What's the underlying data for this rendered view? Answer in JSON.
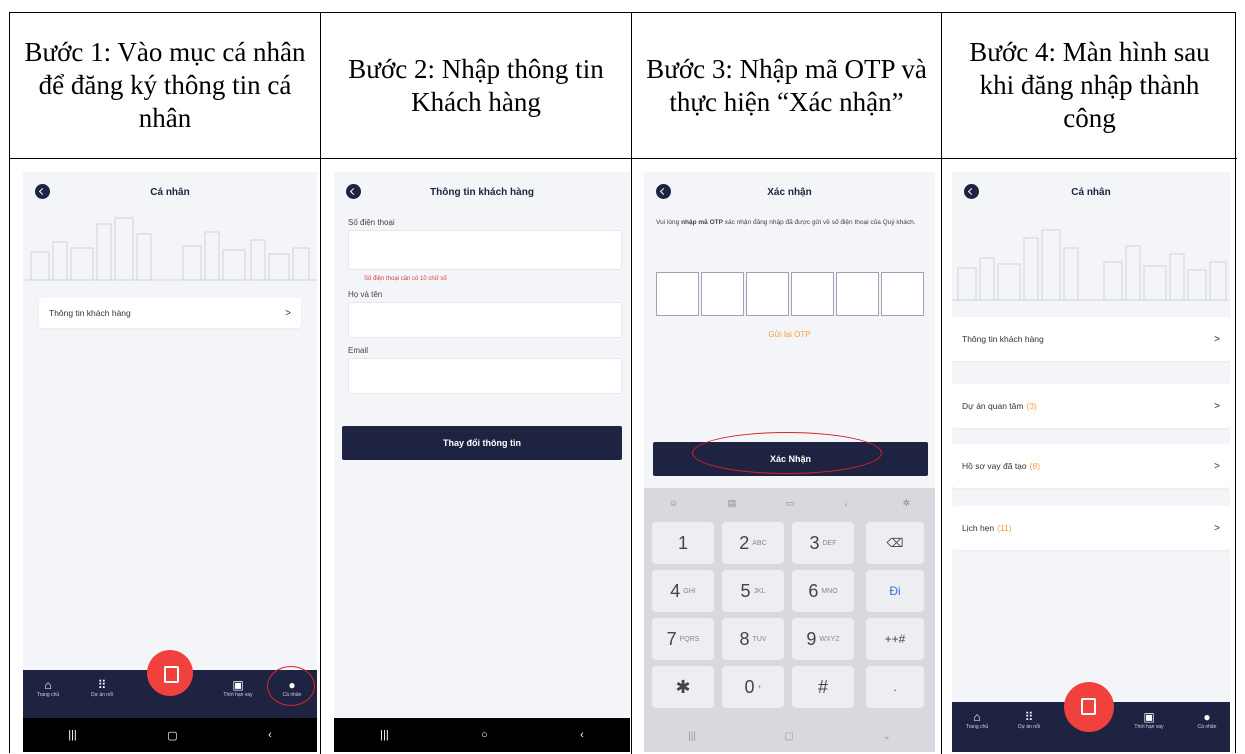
{
  "steps": [
    {
      "title": "Bước 1: Vào mục cá nhân để đăng ký thông tin cá nhân"
    },
    {
      "title": "Bước 2: Nhập thông tin Khách hàng"
    },
    {
      "title": "Bước 3: Nhập mã OTP và thực hiện “Xác nhận”"
    },
    {
      "title": "Bước 4: Màn hình sau khi đăng nhập thành công"
    }
  ],
  "screen1": {
    "title": "Cá nhân",
    "menu": [
      {
        "label": "Thông tin khách hàng",
        "chevron": ">"
      }
    ],
    "nav": [
      "Trang chủ",
      "Dự án nổi",
      "Thời hạn vay",
      "Cá nhân"
    ]
  },
  "screen2": {
    "title": "Thông tin khách hàng",
    "phone_label": "Số điện thoại",
    "phone_error": "Số điện thoại cần có 10 chữ số",
    "name_label": "Họ và tên",
    "email_label": "Email",
    "submit": "Thay đổi thông tin"
  },
  "screen3": {
    "title": "Xác nhận",
    "instruction_prefix": "Vui lòng ",
    "instruction_bold": "nhập mã OTP",
    "instruction_suffix": " xác nhận đăng nhập đã được gửi về số điện thoại của Quý khách.",
    "resend": "Gửi lại OTP",
    "confirm": "Xác Nhận",
    "keys": [
      {
        "main": "1",
        "sub": ""
      },
      {
        "main": "2",
        "sub": "ABC"
      },
      {
        "main": "3",
        "sub": "DEF"
      },
      {
        "main": "⌫",
        "sub": ""
      },
      {
        "main": "4",
        "sub": "GHI"
      },
      {
        "main": "5",
        "sub": "JKL"
      },
      {
        "main": "6",
        "sub": "MNO"
      },
      {
        "main": "Đi",
        "sub": ""
      },
      {
        "main": "7",
        "sub": "PQRS"
      },
      {
        "main": "8",
        "sub": "TUV"
      },
      {
        "main": "9",
        "sub": "WXYZ"
      },
      {
        "main": "++#",
        "sub": ""
      },
      {
        "main": "✱",
        "sub": ""
      },
      {
        "main": "0",
        "sub": "+"
      },
      {
        "main": "#",
        "sub": ""
      },
      {
        "main": ".",
        "sub": ""
      }
    ]
  },
  "screen4": {
    "title": "Cá nhân",
    "menu": [
      {
        "label": "Thông tin khách hàng",
        "count": "",
        "chevron": ">"
      },
      {
        "label": "Dự án quan tâm",
        "count": "(3)",
        "chevron": ">"
      },
      {
        "label": "Hồ sơ vay đã tạo",
        "count": "(8)",
        "chevron": ">"
      },
      {
        "label": "Lịch hẹn",
        "count": "(11)",
        "chevron": ">"
      }
    ],
    "nav": [
      "Trang chủ",
      "Dự án nổi",
      "Thời hạn vay",
      "Cá nhân"
    ]
  },
  "colors": {
    "navy": "#1d2340",
    "red": "#f0413e",
    "orange": "#f3a23b",
    "annotation": "#d9242a"
  }
}
